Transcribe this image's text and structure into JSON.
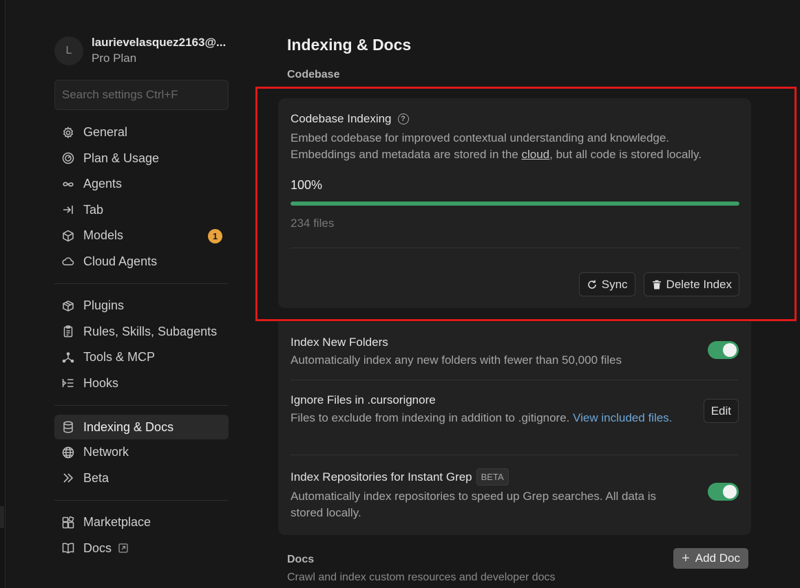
{
  "account": {
    "avatar_initial": "L",
    "email": "laurievelasquez2163@...",
    "plan": "Pro Plan"
  },
  "search": {
    "placeholder": "Search settings Ctrl+F"
  },
  "nav": {
    "group1": [
      {
        "label": "General",
        "icon": "gear-icon"
      },
      {
        "label": "Plan & Usage",
        "icon": "gauge-icon"
      },
      {
        "label": "Agents",
        "icon": "infinity-icon"
      },
      {
        "label": "Tab",
        "icon": "tab-arrow-icon"
      },
      {
        "label": "Models",
        "icon": "cube-icon",
        "badge": "1"
      },
      {
        "label": "Cloud Agents",
        "icon": "cloud-icon"
      }
    ],
    "group2": [
      {
        "label": "Plugins",
        "icon": "box-icon"
      },
      {
        "label": "Rules, Skills, Subagents",
        "icon": "clipboard-icon"
      },
      {
        "label": "Tools & MCP",
        "icon": "tools-icon"
      },
      {
        "label": "Hooks",
        "icon": "hooks-icon"
      }
    ],
    "group3": [
      {
        "label": "Indexing & Docs",
        "icon": "database-icon",
        "active": true
      },
      {
        "label": "Network",
        "icon": "globe-icon"
      },
      {
        "label": "Beta",
        "icon": "double-chevron-icon"
      }
    ],
    "group4": [
      {
        "label": "Marketplace",
        "icon": "marketplace-icon"
      },
      {
        "label": "Docs",
        "icon": "book-icon"
      }
    ]
  },
  "main": {
    "title": "Indexing & Docs",
    "codebase_label": "Codebase",
    "indexing_card": {
      "title": "Codebase Indexing",
      "desc_part1": "Embed codebase for improved contextual understanding and knowledge. Embeddings and metadata are stored in the ",
      "desc_link": "cloud",
      "desc_part2": ", but all code is stored locally.",
      "progress_label": "100%",
      "progress_value": 1.0,
      "files_count": "234 files",
      "sync_label": "Sync",
      "delete_label": "Delete Index"
    },
    "settings": {
      "index_new_folders": {
        "title": "Index New Folders",
        "desc": "Automatically index any new folders with fewer than 50,000 files",
        "enabled": true
      },
      "ignore_files": {
        "title": "Ignore Files in .cursorignore",
        "desc": "Files to exclude from indexing in addition to .gitignore. ",
        "link": "View included files.",
        "edit_label": "Edit"
      },
      "instant_grep": {
        "title": "Index Repositories for Instant Grep",
        "tag": "BETA",
        "desc": "Automatically index repositories to speed up Grep searches. All data is stored locally.",
        "enabled": true
      }
    },
    "docs": {
      "title": "Docs",
      "desc": "Crawl and index custom resources and developer docs",
      "add_label": "Add Doc"
    }
  },
  "colors": {
    "background": "#181818",
    "card": "#222222",
    "accent_green": "#3c9e66",
    "badge_orange": "#e8a33d",
    "highlight_red": "#e11a1a",
    "link_blue": "#6fa6d8"
  }
}
